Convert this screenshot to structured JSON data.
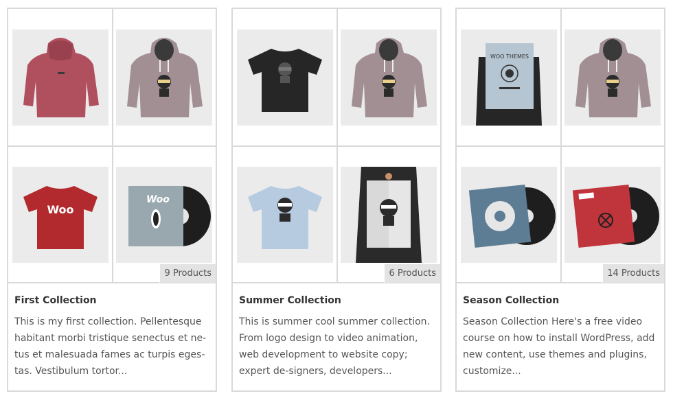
{
  "collections": [
    {
      "title": "First Collection",
      "description": "This is my first collection. Pellentesque habitant morbi tristique senectus et ne-tus et malesuada fames ac turpis eges-tas. Vestibulum tortor...",
      "count_label": "9 Products",
      "products": [
        "hoodie-back-red",
        "hoodie-ninja",
        "tshirt-woo-red",
        "album-woo-vinyl"
      ]
    },
    {
      "title": "Summer Collection",
      "description": "This is summer cool summer collection. From logo design to video animation, web development to website copy; expert de-signers, developers...",
      "count_label": "6 Products",
      "products": [
        "tshirt-ninja-black",
        "hoodie-ninja",
        "tshirt-ninja-blue",
        "poster-ninja"
      ]
    },
    {
      "title": "Season Collection",
      "description": "Season Collection Here's a free video course on how to install WordPress, add new content, use themes and plugins, customize...",
      "count_label": "14 Products",
      "products": [
        "poster-woo-themes",
        "hoodie-ninja",
        "album-blue-vinyl",
        "album-red-vinyl"
      ]
    }
  ],
  "colors": {
    "border": "#d9d9d9",
    "thumb_bg": "#ebebeb",
    "badge_bg": "#e3e3e3",
    "hoodie_red": "#b0505f",
    "hoodie_mauve": "#a18f93",
    "shirt_red": "#b32a2e",
    "shirt_black": "#262626",
    "shirt_blue": "#b7cbe0"
  }
}
